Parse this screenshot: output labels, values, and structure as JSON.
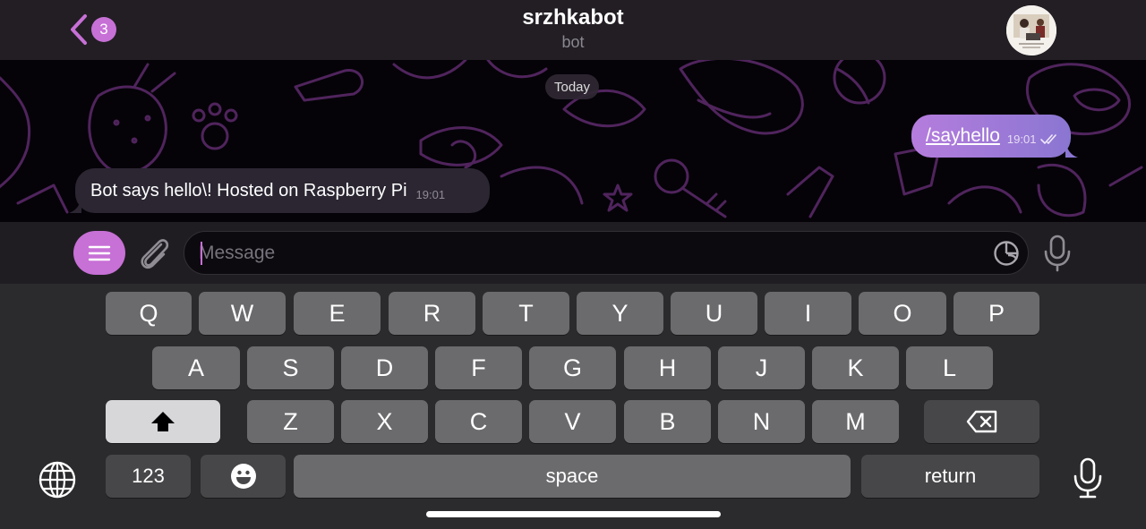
{
  "header": {
    "back_count": "3",
    "title": "srzhkabot",
    "subtitle": "bot",
    "icons": [
      "chevron-left-icon",
      "avatar"
    ]
  },
  "chat": {
    "date_label": "Today",
    "messages": [
      {
        "direction": "out",
        "text": "/sayhello",
        "time": "19:01",
        "status": "read"
      },
      {
        "direction": "in",
        "text": "Bot says hello\\! Hosted on Raspberry Pi",
        "time": "19:01"
      }
    ]
  },
  "input": {
    "placeholder": "Message",
    "value": "",
    "icons": [
      "menu-icon",
      "paperclip-icon",
      "sticker-icon",
      "microphone-icon"
    ]
  },
  "keyboard": {
    "row1": [
      "Q",
      "W",
      "E",
      "R",
      "T",
      "Y",
      "U",
      "I",
      "O",
      "P"
    ],
    "row2": [
      "A",
      "S",
      "D",
      "F",
      "G",
      "H",
      "J",
      "K",
      "L"
    ],
    "row3": [
      "Z",
      "X",
      "C",
      "V",
      "B",
      "N",
      "M"
    ],
    "numbers_label": "123",
    "space_label": "space",
    "return_label": "return",
    "icons": [
      "shift-icon",
      "backspace-icon",
      "emoji-icon",
      "globe-icon",
      "dictation-icon"
    ]
  },
  "colors": {
    "accent": "#c770d6",
    "bubble_out_start": "#b57ddd",
    "bubble_out_end": "#8a76d2",
    "bubble_in": "#2b2632",
    "key": "#6b6b6e"
  }
}
